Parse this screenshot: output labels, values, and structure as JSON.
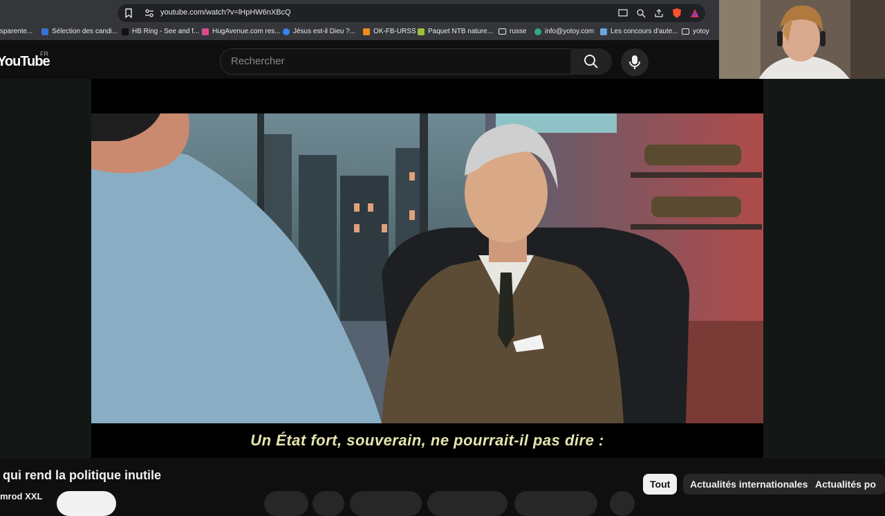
{
  "browser": {
    "url": "youtube.com/watch?v=lHpHW6nXBcQ",
    "bookmarks": [
      "sparente...",
      "Sélection des candi...",
      "HB Ring - See and f...",
      "HugAvenue.com res...",
      "Jésus est-il Dieu ?...",
      "OK-FB-URSS",
      "Paquet NTB nature...",
      "russe",
      "info@yotoy.com",
      "Les concours d'aute...",
      "yotoy"
    ],
    "icons": [
      "bookmark-icon",
      "site-settings-icon",
      "cast-icon",
      "zoom-icon",
      "share-icon",
      "brave-shield-icon",
      "brave-rewards-icon"
    ]
  },
  "youtube": {
    "logo": "YouTube",
    "region": "FR",
    "search_placeholder": "Rechercher"
  },
  "video": {
    "subtitle": "Un État fort, souverain, ne pourrait-il pas dire :",
    "title": "qui rend la politique inutile",
    "channel": "mrod XXL"
  },
  "chips": [
    "Tout",
    "Actualités internationales",
    "Actualités po"
  ],
  "colors": {
    "background": "#0f0f0f",
    "chrome": "#35363a",
    "subtitle": "#e6e6b0",
    "chip": "#272727",
    "chip_active": "#f1f1f1"
  }
}
